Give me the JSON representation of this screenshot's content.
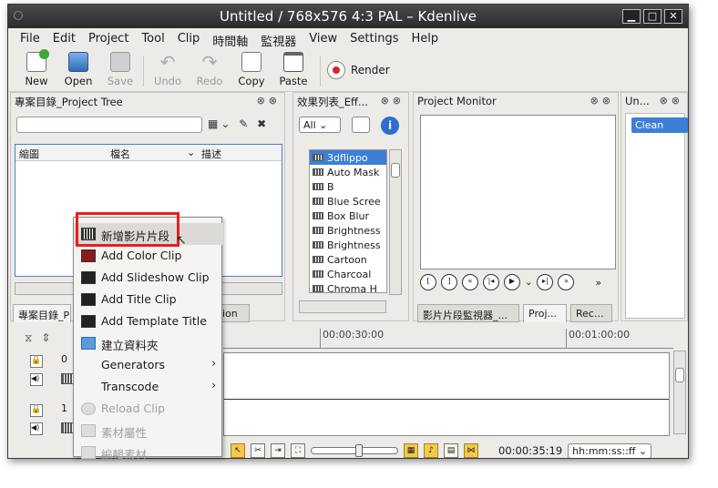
{
  "window": {
    "title": "Untitled / 768x576 4:3 PAL  –  Kdenlive"
  },
  "menu": [
    "File",
    "Edit",
    "Project",
    "Tool",
    "Clip",
    "時間軸",
    "監視器",
    "View",
    "Settings",
    "Help"
  ],
  "toolbar": {
    "new": "New",
    "open": "Open",
    "save": "Save",
    "undo": "Undo",
    "redo": "Redo",
    "copy": "Copy",
    "paste": "Paste",
    "render": "Render"
  },
  "project_tree": {
    "title": "專案目錄_Project Tree",
    "columns": [
      "縮圖",
      "檔名",
      "描述"
    ],
    "tab_label": "專案目錄_Pr",
    "tab_label2": "ion"
  },
  "effects": {
    "title": "效果列表_Eff...",
    "filter": "All",
    "items": [
      "3dflippo",
      "Auto Mask",
      "B",
      "Blue Scree",
      "Box Blur",
      "Brightness",
      "Brightness",
      "Cartoon",
      "Charcoal",
      "Chroma H"
    ]
  },
  "monitor": {
    "title": "Project Monitor",
    "tabs": [
      "影片片段監視器_...",
      "Proj...",
      "Rec..."
    ]
  },
  "undo_panel": {
    "title": "Un...",
    "item": "Clean"
  },
  "timeline": {
    "ruler": [
      "00:00:30:00",
      "00:01:00:00"
    ],
    "tracks": [
      "0",
      "1"
    ]
  },
  "status": {
    "timecode": "00:00:35:19",
    "format": "hh:mm:ss::ff"
  },
  "context_menu": {
    "items": [
      {
        "label": "新增影片片段",
        "disabled": false
      },
      {
        "label": "Add Color Clip",
        "disabled": false
      },
      {
        "label": "Add Slideshow Clip",
        "disabled": false
      },
      {
        "label": "Add Title Clip",
        "disabled": false
      },
      {
        "label": "Add Template Title",
        "disabled": false
      },
      {
        "label": "建立資料夾",
        "disabled": false
      },
      {
        "label": "Generators",
        "disabled": false
      },
      {
        "label": "Transcode",
        "disabled": false
      },
      {
        "label": "Reload Clip",
        "disabled": true
      },
      {
        "label": "素材屬性",
        "disabled": true
      },
      {
        "label": "編輯素材",
        "disabled": true
      }
    ]
  },
  "colors": {
    "highlight": "#3d7fd6",
    "annotation": "#e52020",
    "render_dot": "#d4242a"
  }
}
